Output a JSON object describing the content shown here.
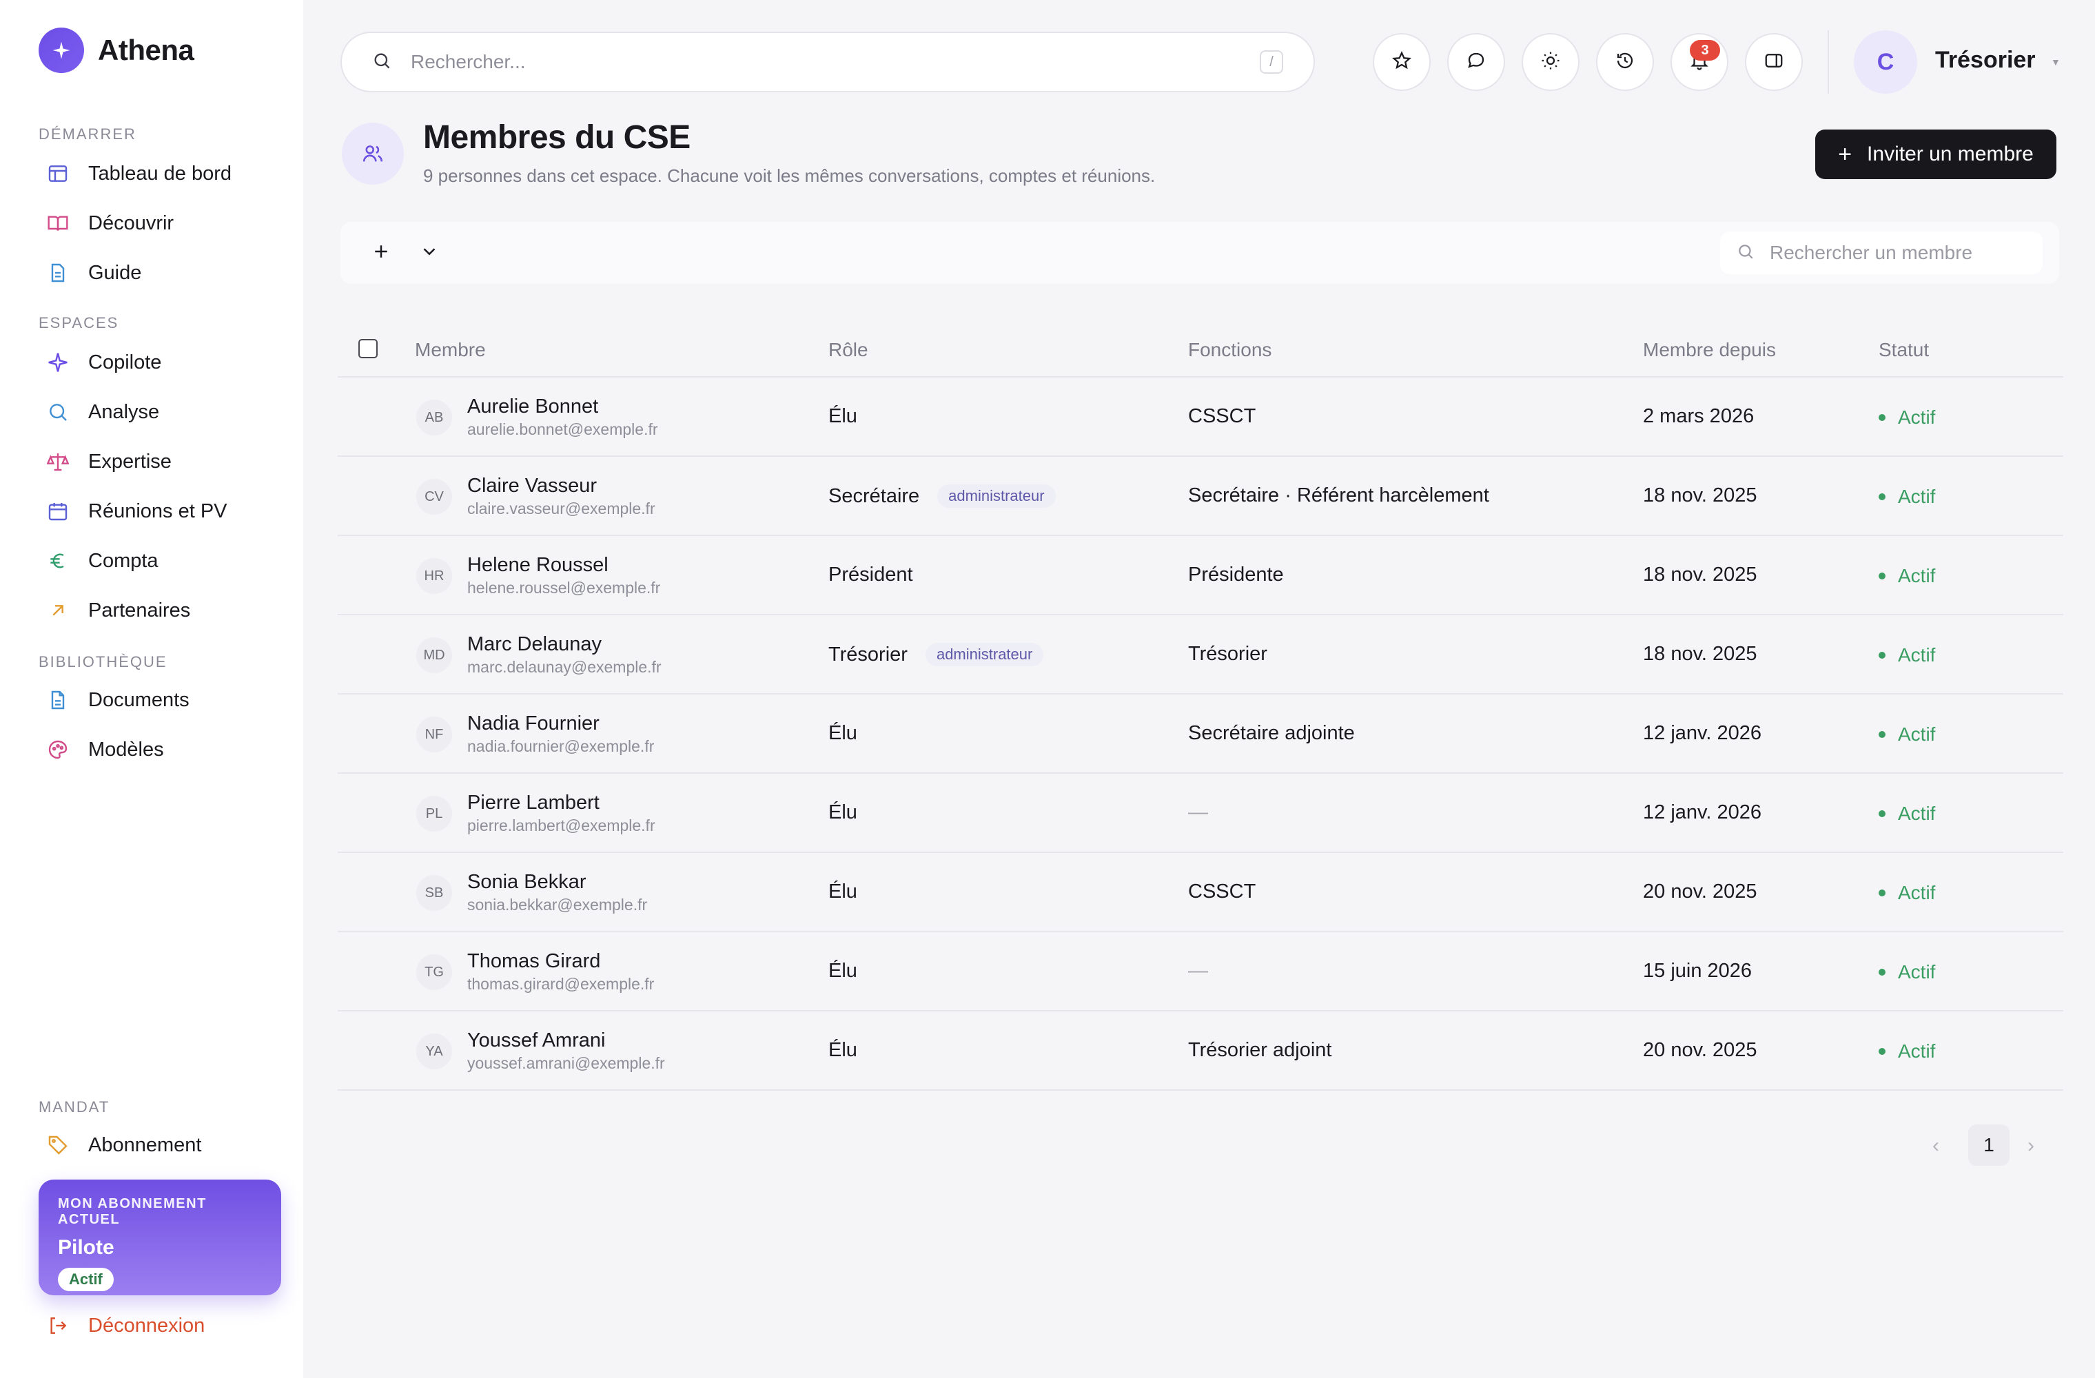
{
  "brand": {
    "name": "Athena"
  },
  "sidebar": {
    "sections": [
      {
        "label": "Démarrer",
        "items": [
          {
            "label": "Tableau de bord",
            "icon": "layout-icon",
            "color": "#5b5fd6"
          },
          {
            "label": "Découvrir",
            "icon": "book-open-icon",
            "color": "#d24c8a"
          },
          {
            "label": "Guide",
            "icon": "file-text-icon",
            "color": "#3f8fd4"
          }
        ]
      },
      {
        "label": "Espaces",
        "items": [
          {
            "label": "Copilote",
            "icon": "sparkle-icon",
            "color": "#6c4ee6"
          },
          {
            "label": "Analyse",
            "icon": "search-icon",
            "color": "#3f8fd4"
          },
          {
            "label": "Expertise",
            "icon": "scale-icon",
            "color": "#d24c8a"
          },
          {
            "label": "Réunions et PV",
            "icon": "calendar-icon",
            "color": "#5b5fd6"
          },
          {
            "label": "Compta",
            "icon": "euro-icon",
            "color": "#2f9d6b"
          },
          {
            "label": "Partenaires",
            "icon": "arrow-up-right-icon",
            "color": "#e39b2d"
          }
        ]
      },
      {
        "label": "Bibliothèque",
        "items": [
          {
            "label": "Documents",
            "icon": "document-icon",
            "color": "#3f8fd4"
          },
          {
            "label": "Modèles",
            "icon": "palette-icon",
            "color": "#d24c8a"
          }
        ]
      },
      {
        "label": "Mandat",
        "items": [
          {
            "label": "Abonnement",
            "icon": "tag-icon",
            "color": "#e39b2d"
          }
        ]
      }
    ],
    "plan": {
      "kicker": "MON ABONNEMENT ACTUEL",
      "name": "Pilote",
      "status": "Actif"
    },
    "logout": "Déconnexion"
  },
  "topbar": {
    "search_placeholder": "Rechercher...",
    "shortcut": "/",
    "notification_count": "3",
    "user_initial": "C",
    "user_name": "Trésorier"
  },
  "page": {
    "title": "Membres du CSE",
    "subtitle": "9 personnes dans cet espace. Chacune voit les mêmes conversations, comptes et réunions.",
    "invite_label": "Inviter un membre",
    "member_search_placeholder": "Rechercher un membre"
  },
  "table": {
    "columns": [
      "Membre",
      "Rôle",
      "Fonctions",
      "Membre depuis",
      "Statut"
    ],
    "rows": [
      {
        "initials": "AB",
        "name": "Aurelie Bonnet",
        "email": "aurelie.bonnet@exemple.fr",
        "role": "Élu",
        "admin": "",
        "functions": "CSSCT",
        "since": "2 mars 2026",
        "status": "Actif"
      },
      {
        "initials": "CV",
        "name": "Claire Vasseur",
        "email": "claire.vasseur@exemple.fr",
        "role": "Secrétaire",
        "admin": "administrateur",
        "functions": "Secrétaire · Référent harcèlement",
        "since": "18 nov. 2025",
        "status": "Actif"
      },
      {
        "initials": "HR",
        "name": "Helene Roussel",
        "email": "helene.roussel@exemple.fr",
        "role": "Président",
        "admin": "",
        "functions": "Présidente",
        "since": "18 nov. 2025",
        "status": "Actif"
      },
      {
        "initials": "MD",
        "name": "Marc Delaunay",
        "email": "marc.delaunay@exemple.fr",
        "role": "Trésorier",
        "admin": "administrateur",
        "functions": "Trésorier",
        "since": "18 nov. 2025",
        "status": "Actif"
      },
      {
        "initials": "NF",
        "name": "Nadia Fournier",
        "email": "nadia.fournier@exemple.fr",
        "role": "Élu",
        "admin": "",
        "functions": "Secrétaire adjointe",
        "since": "12 janv. 2026",
        "status": "Actif"
      },
      {
        "initials": "PL",
        "name": "Pierre Lambert",
        "email": "pierre.lambert@exemple.fr",
        "role": "Élu",
        "admin": "",
        "functions": "—",
        "since": "12 janv. 2026",
        "status": "Actif"
      },
      {
        "initials": "SB",
        "name": "Sonia Bekkar",
        "email": "sonia.bekkar@exemple.fr",
        "role": "Élu",
        "admin": "",
        "functions": "CSSCT",
        "since": "20 nov. 2025",
        "status": "Actif"
      },
      {
        "initials": "TG",
        "name": "Thomas Girard",
        "email": "thomas.girard@exemple.fr",
        "role": "Élu",
        "admin": "",
        "functions": "—",
        "since": "15 juin 2026",
        "status": "Actif"
      },
      {
        "initials": "YA",
        "name": "Youssef Amrani",
        "email": "youssef.amrani@exemple.fr",
        "role": "Élu",
        "admin": "",
        "functions": "Trésorier adjoint",
        "since": "20 nov. 2025",
        "status": "Actif"
      }
    ]
  },
  "pagination": {
    "current": "1"
  },
  "colors": {
    "accent": "#6c4ee6",
    "status_active": "#3a9e63",
    "danger": "#d94f2e",
    "notification": "#e5483b"
  }
}
